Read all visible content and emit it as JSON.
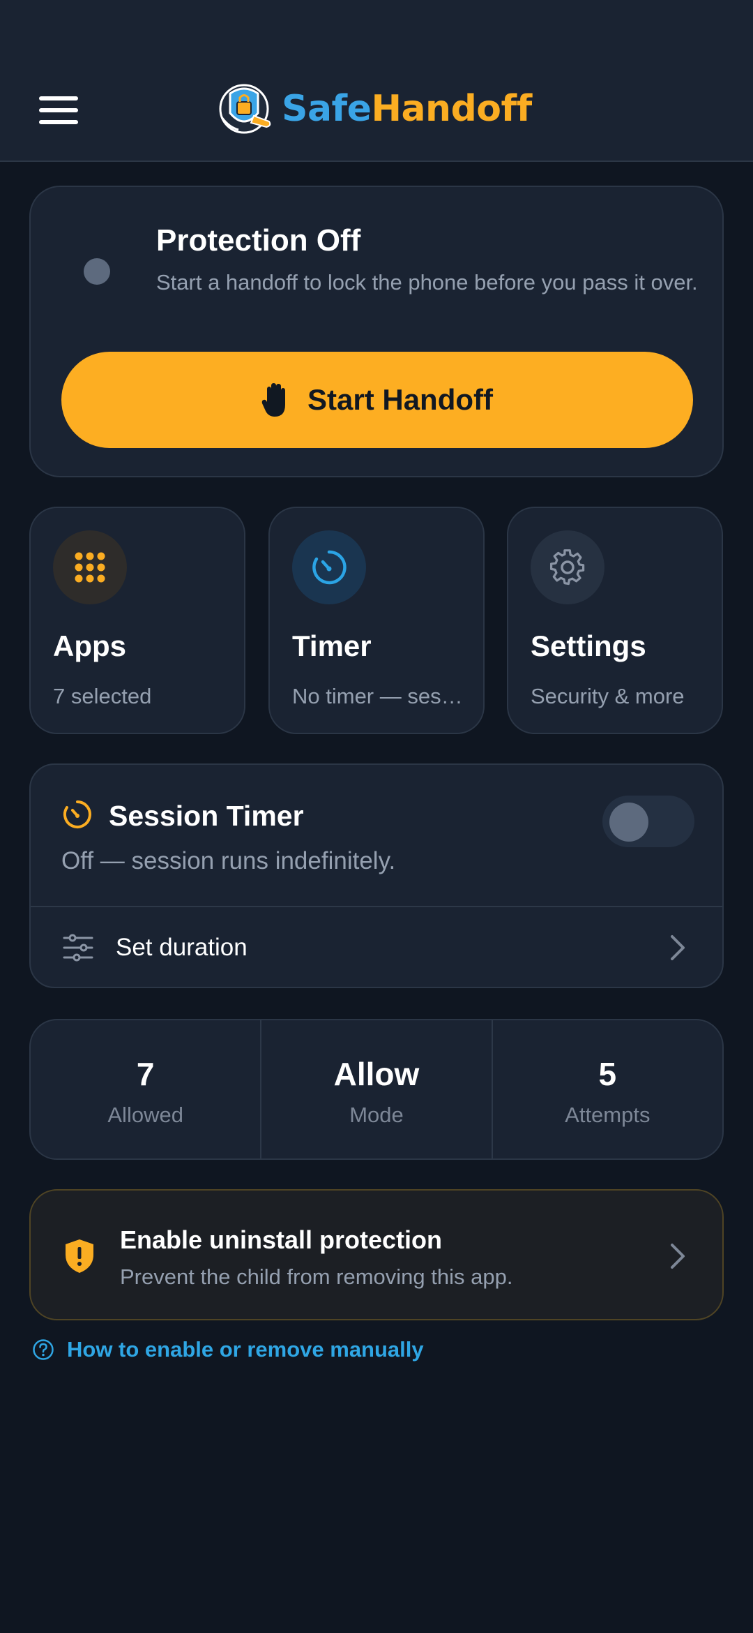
{
  "app": {
    "brand_part1": "Safe",
    "brand_part2": "Handoff"
  },
  "protection": {
    "title": "Protection Off",
    "subtitle": "Start a handoff to lock the phone before you pass it over.",
    "status_color": "#5d6a7e",
    "button_label": "Start Handoff",
    "button_icon": "hand-icon",
    "button_color": "#fdae22"
  },
  "tiles": [
    {
      "title": "Apps",
      "subtitle": "7 selected",
      "icon": "apps-grid-icon",
      "accent": "#fbad22"
    },
    {
      "title": "Timer",
      "subtitle": "No timer — session runs indefinitely",
      "icon": "timer-icon",
      "accent": "#2ba4e5"
    },
    {
      "title": "Settings",
      "subtitle": "Security & more",
      "icon": "gear-icon",
      "accent": "#8b95a5"
    }
  ],
  "session": {
    "title": "Session Timer",
    "subtitle": "Off — session runs indefinitely.",
    "enabled": false,
    "set_duration_label": "Set duration"
  },
  "stats": [
    {
      "value": "7",
      "label": "Allowed"
    },
    {
      "value": "Allow",
      "label": "Mode"
    },
    {
      "value": "5",
      "label": "Attempts"
    }
  ],
  "uninstall": {
    "title": "Enable uninstall protection",
    "subtitle": "Prevent the child from removing this app.",
    "accent": "#fbad22"
  },
  "help": {
    "label": "How to enable or remove manually"
  }
}
